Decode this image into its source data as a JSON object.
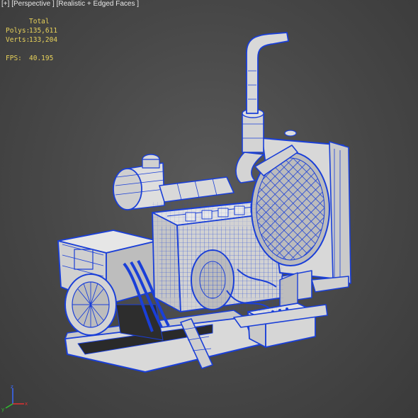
{
  "viewport": {
    "menu_plus": "[+]",
    "view_name": "[Perspective ]",
    "shading_mode": "[Realistic + Edged Faces ]"
  },
  "stats": {
    "header": "Total",
    "polys_label": "Polys:",
    "polys_value": "135,611",
    "verts_label": "Verts:",
    "verts_value": "133,204",
    "fps_label": "FPS:",
    "fps_value": "40.195"
  },
  "colors": {
    "wire": "#1a3fd8",
    "stats_text": "#e8d25a",
    "background": "#474747"
  },
  "icons": {
    "axis_gizmo": "xyz-axis-tripod-icon"
  }
}
